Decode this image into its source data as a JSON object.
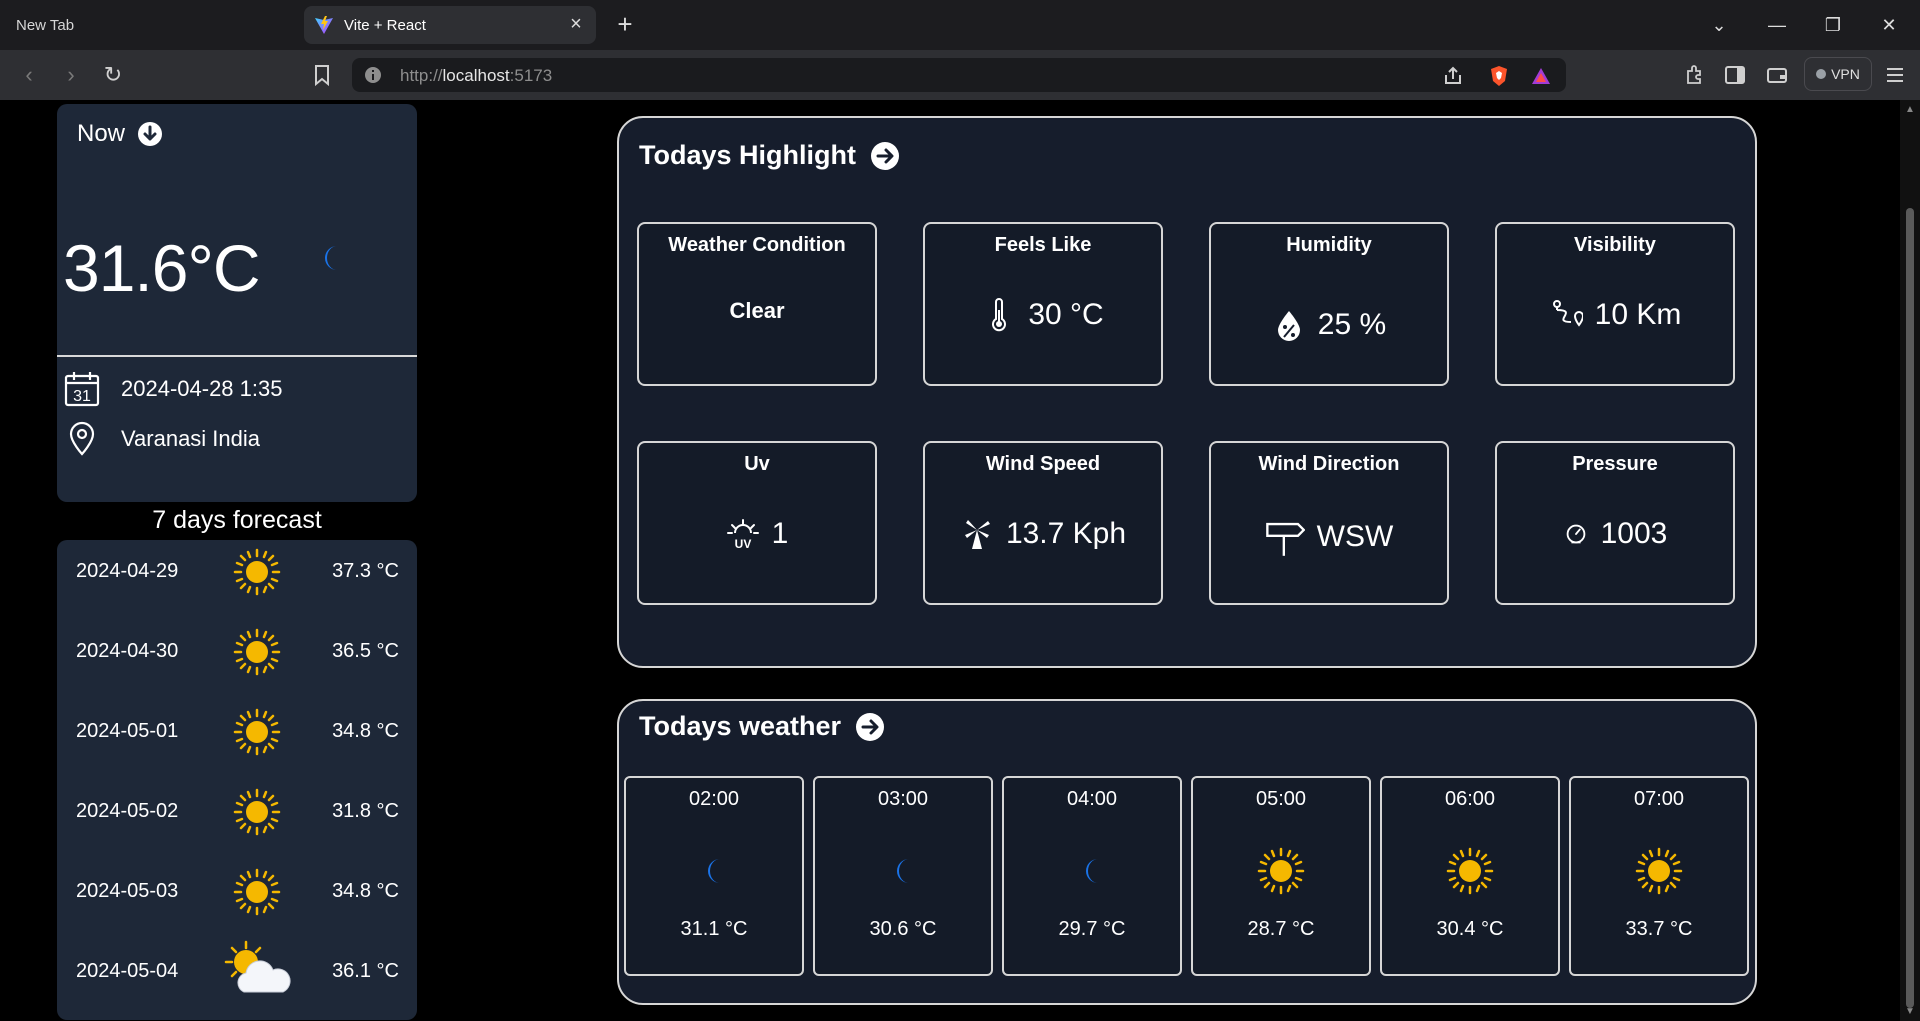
{
  "browser": {
    "tabs": [
      {
        "label": "New Tab",
        "active": false
      },
      {
        "label": "Vite + React",
        "active": true
      }
    ],
    "url_prefix": "http://",
    "url_host": "localhost",
    "url_suffix": ":5173",
    "vpn_label": "VPN"
  },
  "now": {
    "title": "Now",
    "temperature": "31.6°C",
    "icon": "moon-icon",
    "datetime": "2024-04-28 1:35",
    "calendar_day": "31",
    "location": "Varanasi India"
  },
  "forecast": {
    "title": "7 days forecast",
    "days": [
      {
        "date": "2024-04-29",
        "icon": "sun-icon",
        "temp": "37.3 °C"
      },
      {
        "date": "2024-04-30",
        "icon": "sun-icon",
        "temp": "36.5 °C"
      },
      {
        "date": "2024-05-01",
        "icon": "sun-icon",
        "temp": "34.8 °C"
      },
      {
        "date": "2024-05-02",
        "icon": "sun-icon",
        "temp": "31.8 °C"
      },
      {
        "date": "2024-05-03",
        "icon": "sun-icon",
        "temp": "34.8 °C"
      },
      {
        "date": "2024-05-04",
        "icon": "partly-cloudy-icon",
        "temp": "36.1 °C"
      }
    ]
  },
  "highlights": {
    "title": "Todays Highlight",
    "items": [
      {
        "label": "Weather Condition",
        "value": "Clear",
        "icon": ""
      },
      {
        "label": "Feels Like",
        "value": "30 °C",
        "icon": "thermometer-icon"
      },
      {
        "label": "Humidity",
        "value": "25 %",
        "icon": "humidity-drop-icon"
      },
      {
        "label": "Visibility",
        "value": "10 Km",
        "icon": "route-icon"
      },
      {
        "label": "Uv",
        "value": "1",
        "icon": "uv-icon"
      },
      {
        "label": "Wind Speed",
        "value": "13.7 Kph",
        "icon": "windmill-icon"
      },
      {
        "label": "Wind Direction",
        "value": "WSW",
        "icon": "signpost-icon"
      },
      {
        "label": "Pressure",
        "value": "1003",
        "icon": "gauge-icon"
      }
    ]
  },
  "today": {
    "title": "Todays weather",
    "hours": [
      {
        "time": "02:00",
        "icon": "moon-icon",
        "temp": "31.1 °C"
      },
      {
        "time": "03:00",
        "icon": "moon-icon",
        "temp": "30.6 °C"
      },
      {
        "time": "04:00",
        "icon": "moon-icon",
        "temp": "29.7 °C"
      },
      {
        "time": "05:00",
        "icon": "sun-icon",
        "temp": "28.7 °C"
      },
      {
        "time": "06:00",
        "icon": "sun-icon",
        "temp": "30.4 °C"
      },
      {
        "time": "07:00",
        "icon": "sun-icon",
        "temp": "33.7 °C"
      }
    ]
  },
  "colors": {
    "page_bg": "#000000",
    "card_bg": "#1e2838",
    "panel_bg": "#161d2c",
    "sun": "#f5b800",
    "moon": "#1a73e8"
  }
}
